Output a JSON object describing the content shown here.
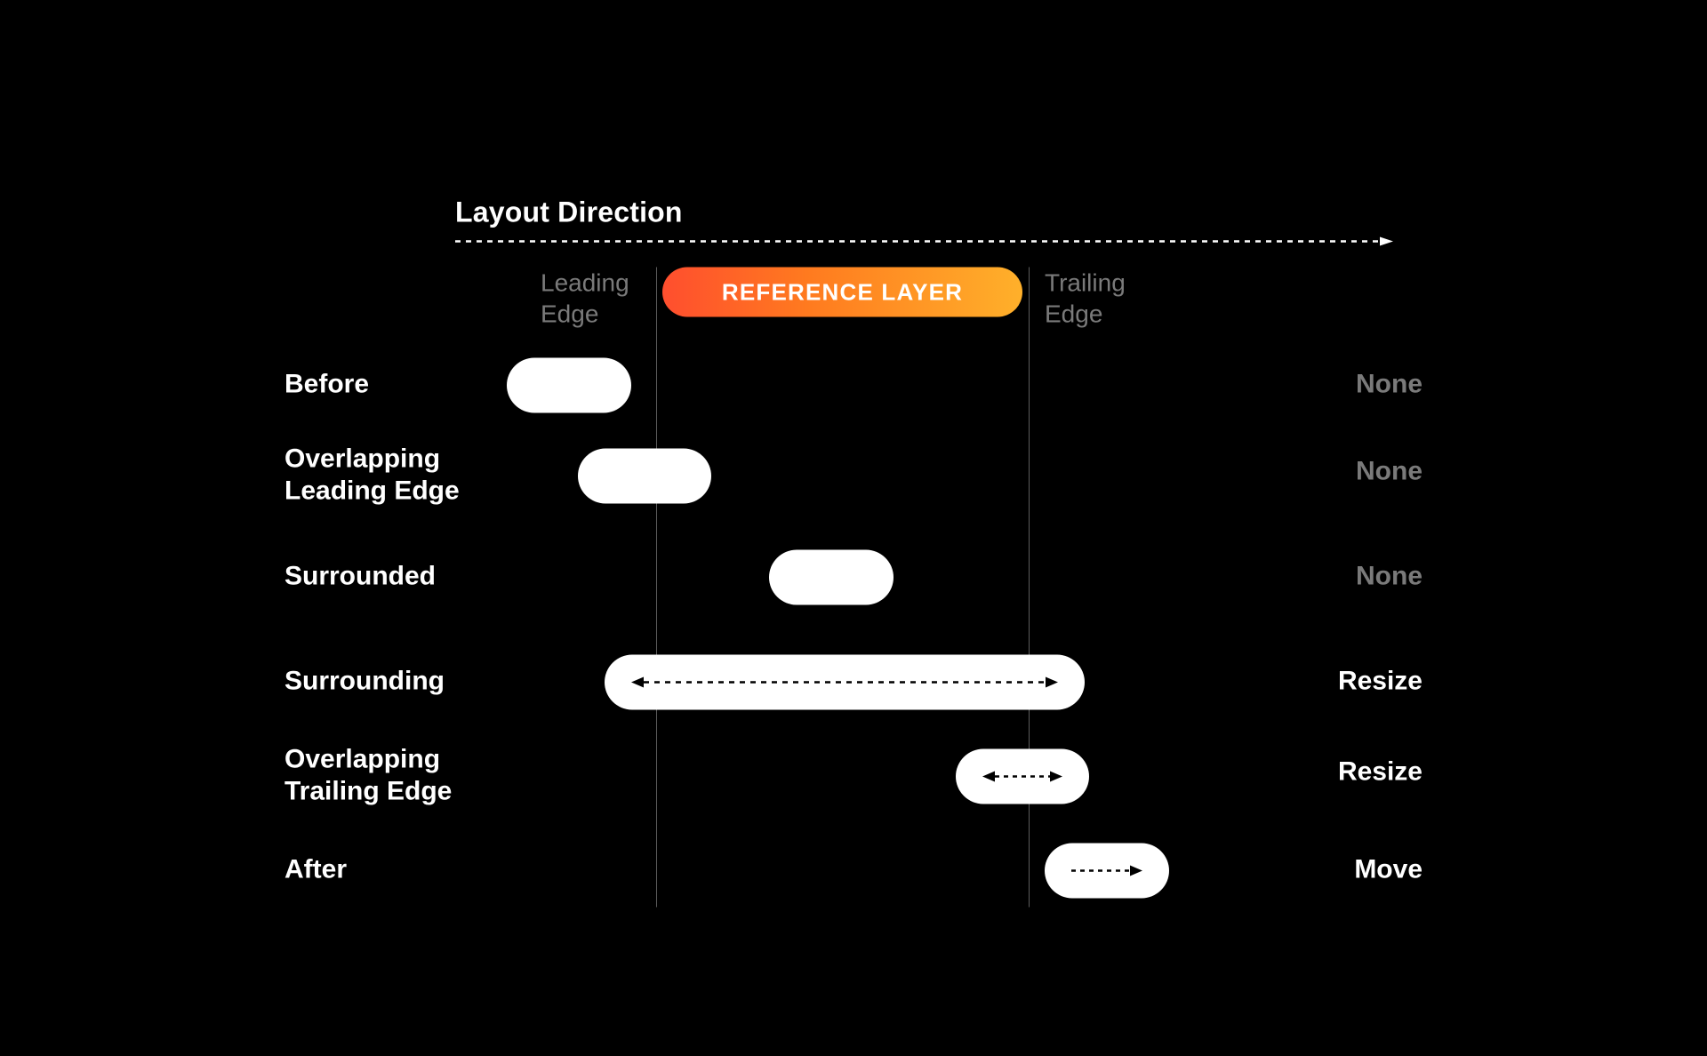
{
  "header": {
    "title": "Layout Direction"
  },
  "guides": {
    "leading_line1": "Leading",
    "leading_line2": "Edge",
    "trailing_line1": "Trailing",
    "trailing_line2": "Edge"
  },
  "reference": {
    "label": "REFERENCE LAYER"
  },
  "rows": [
    {
      "label_line1": "Before",
      "label_line2": "",
      "outcome": "None",
      "outcome_bright": false
    },
    {
      "label_line1": "Overlapping",
      "label_line2": "Leading Edge",
      "outcome": "None",
      "outcome_bright": false
    },
    {
      "label_line1": "Surrounded",
      "label_line2": "",
      "outcome": "None",
      "outcome_bright": false
    },
    {
      "label_line1": "Surrounding",
      "label_line2": "",
      "outcome": "Resize",
      "outcome_bright": true
    },
    {
      "label_line1": "Overlapping",
      "label_line2": "Trailing Edge",
      "outcome": "Resize",
      "outcome_bright": true
    },
    {
      "label_line1": "After",
      "label_line2": "",
      "outcome": "Move",
      "outcome_bright": true
    }
  ]
}
